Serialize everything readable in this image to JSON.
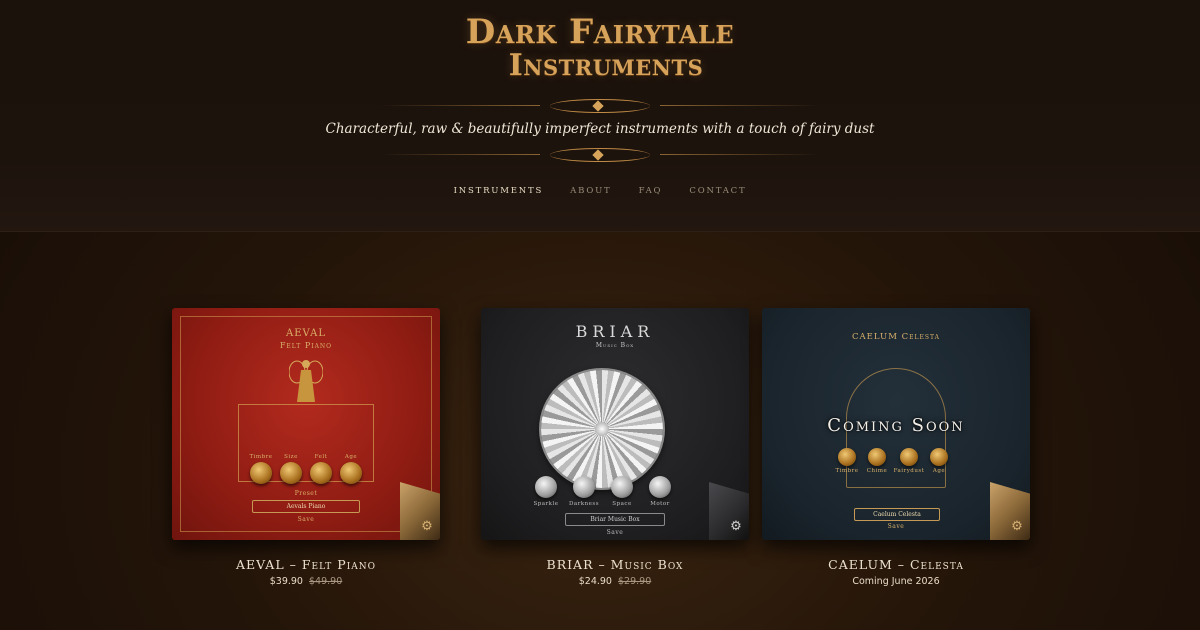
{
  "brand": {
    "line1": "Dark Fairytale",
    "line2": "Instruments",
    "tagline": "Characterful, raw & beautifully imperfect instruments with a touch of fairy dust"
  },
  "nav": [
    {
      "label": "INSTRUMENTS",
      "active": true
    },
    {
      "label": "ABOUT",
      "active": false
    },
    {
      "label": "FAQ",
      "active": false
    },
    {
      "label": "CONTACT",
      "active": false
    }
  ],
  "products": [
    {
      "name": "AEVAL – Felt Piano",
      "price": "$39.90",
      "old_price": "$49.90",
      "cover": {
        "title": "AEVAL",
        "subtitle": "Felt Piano",
        "knobs": [
          "Timbre",
          "Size",
          "Felt",
          "Age"
        ],
        "preset_label": "Preset",
        "preset_value": "Aevals Piano",
        "save_label": "Save"
      }
    },
    {
      "name": "BRIAR – Music Box",
      "price": "$24.90",
      "old_price": "$29.90",
      "cover": {
        "title": "BRIAR",
        "subtitle": "Music Box",
        "knobs": [
          "Sparkle",
          "Darkness",
          "Space",
          "Motor"
        ],
        "preset_value": "Briar Music Box",
        "save_label": "Save"
      }
    },
    {
      "name": "CAELUM – Celesta",
      "price": "Coming June 2026",
      "cover": {
        "title": "CAELUM Celesta",
        "overlay": "Coming Soon",
        "knobs": [
          "Timbre",
          "Chime",
          "Fairydust",
          "Age"
        ],
        "preset_value": "Caelum Celesta",
        "save_label": "Save"
      }
    }
  ],
  "icons": {
    "settings": "gear-icon"
  },
  "colors": {
    "gold": "#d7a35a",
    "background": "#1b120c",
    "red_cover": "#a3231a",
    "dark_cover": "#232325",
    "navy_cover": "#1e2933"
  }
}
